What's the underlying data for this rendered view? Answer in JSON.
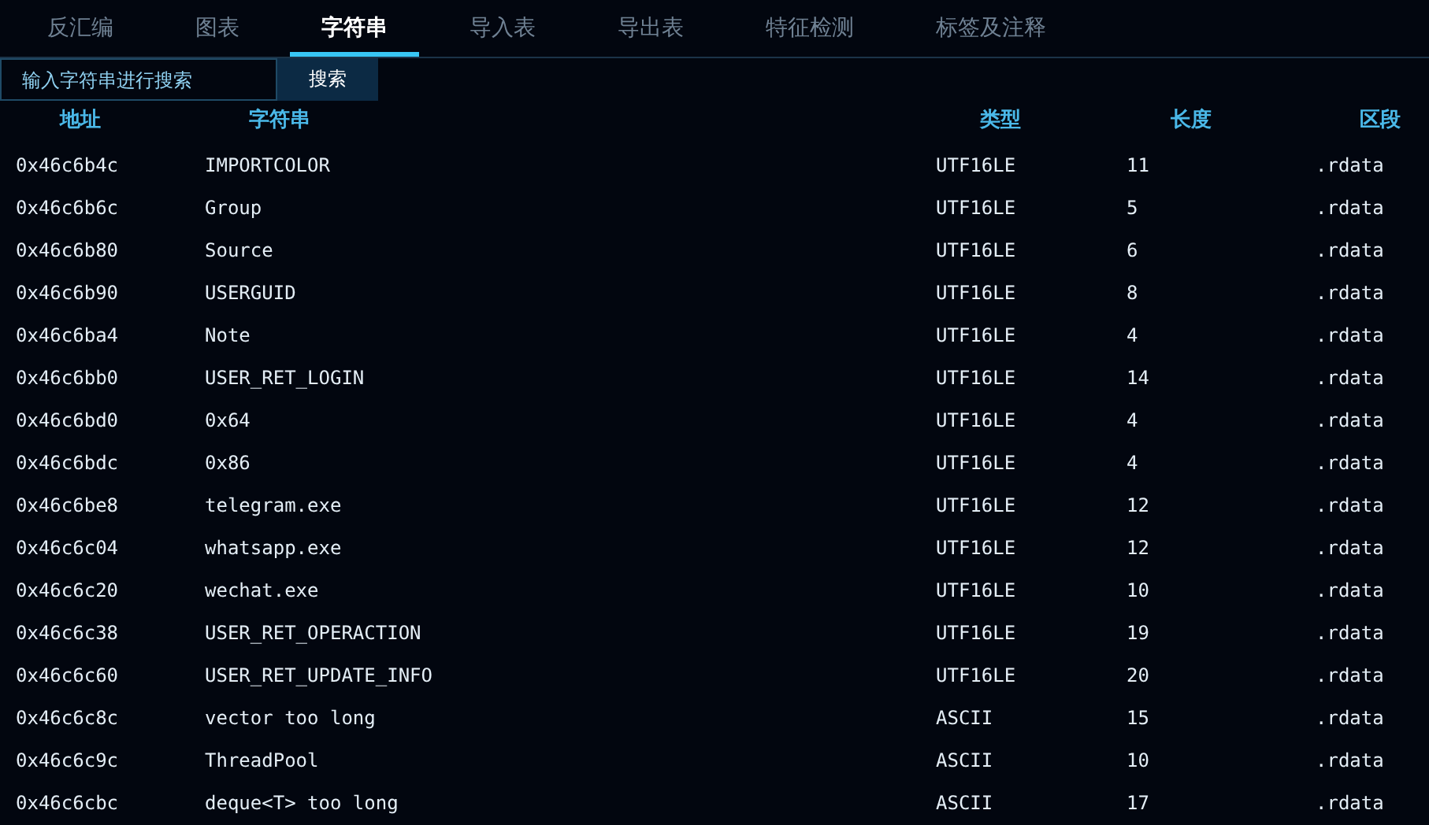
{
  "tabs": [
    {
      "label": "反汇编",
      "selected": false
    },
    {
      "label": "图表",
      "selected": false
    },
    {
      "label": "字符串",
      "selected": true
    },
    {
      "label": "导入表",
      "selected": false
    },
    {
      "label": "导出表",
      "selected": false
    },
    {
      "label": "特征检测",
      "selected": false
    },
    {
      "label": "标签及注释",
      "selected": false
    }
  ],
  "search": {
    "placeholder": "输入字符串进行搜索",
    "button": "搜索"
  },
  "table": {
    "columns": [
      "地址",
      "字符串",
      "类型",
      "长度",
      "区段"
    ],
    "rows": [
      [
        "0x46c6b4c",
        "IMPORTCOLOR",
        "UTF16LE",
        "11",
        ".rdata"
      ],
      [
        "0x46c6b6c",
        "Group",
        "UTF16LE",
        "5",
        ".rdata"
      ],
      [
        "0x46c6b80",
        "Source",
        "UTF16LE",
        "6",
        ".rdata"
      ],
      [
        "0x46c6b90",
        "USERGUID",
        "UTF16LE",
        "8",
        ".rdata"
      ],
      [
        "0x46c6ba4",
        "Note",
        "UTF16LE",
        "4",
        ".rdata"
      ],
      [
        "0x46c6bb0",
        "USER_RET_LOGIN",
        "UTF16LE",
        "14",
        ".rdata"
      ],
      [
        "0x46c6bd0",
        "0x64",
        "UTF16LE",
        "4",
        ".rdata"
      ],
      [
        "0x46c6bdc",
        "0x86",
        "UTF16LE",
        "4",
        ".rdata"
      ],
      [
        "0x46c6be8",
        "telegram.exe",
        "UTF16LE",
        "12",
        ".rdata"
      ],
      [
        "0x46c6c04",
        "whatsapp.exe",
        "UTF16LE",
        "12",
        ".rdata"
      ],
      [
        "0x46c6c20",
        "wechat.exe",
        "UTF16LE",
        "10",
        ".rdata"
      ],
      [
        "0x46c6c38",
        "USER_RET_OPERACTION",
        "UTF16LE",
        "19",
        ".rdata"
      ],
      [
        "0x46c6c60",
        "USER_RET_UPDATE_INFO",
        "UTF16LE",
        "20",
        ".rdata"
      ],
      [
        "0x46c6c8c",
        "vector too long",
        "ASCII",
        "15",
        ".rdata"
      ],
      [
        "0x46c6c9c",
        "ThreadPool",
        "ASCII",
        "10",
        ".rdata"
      ],
      [
        "0x46c6cbc",
        "deque<T> too long",
        "ASCII",
        "17",
        ".rdata"
      ]
    ]
  }
}
